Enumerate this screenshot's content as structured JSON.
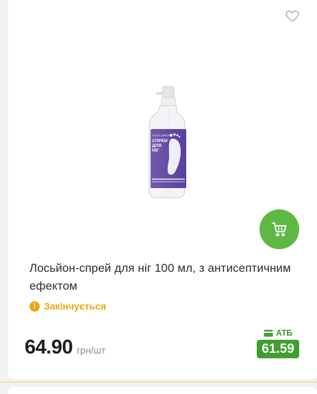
{
  "product": {
    "title": "Лосьйон-спрей для ніг 100 мл, з антисептичним ефектом",
    "image": {
      "label_top": "FOOT SPRAY",
      "label_main": "СПРЕЙ ДЛЯ НІГ"
    },
    "status": {
      "text": "Закінчується",
      "icon": "warning-icon",
      "color": "#f2a20c"
    },
    "price": {
      "value": "64.90",
      "unit": "грн/шт"
    },
    "card_price": {
      "label": "АТБ",
      "value": "61.59",
      "icon": "card-icon",
      "color": "#3f9e2f"
    }
  },
  "colors": {
    "accent_green": "#5fb843",
    "divider": "#f3d35a"
  }
}
